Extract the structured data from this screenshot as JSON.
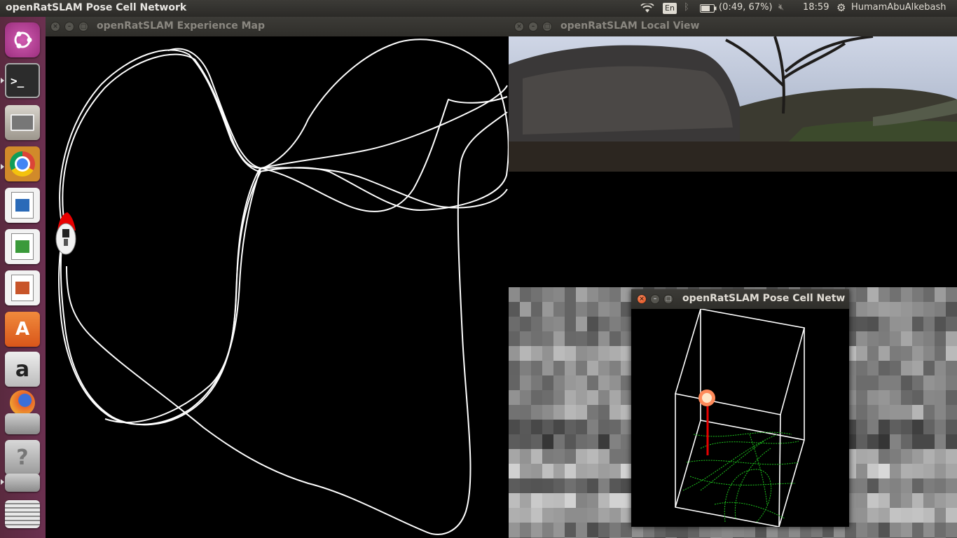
{
  "top_panel": {
    "active_window_title": "openRatSLAM Pose Cell Network",
    "keyboard_lang": "En",
    "battery_text": "(0:49, 67%)",
    "clock": "18:59",
    "username": "HumamAbuAlkebash",
    "icons": [
      "wifi-icon",
      "bluetooth-icon",
      "battery-icon",
      "volume-muted-icon",
      "gear-icon"
    ]
  },
  "launcher": {
    "items": [
      {
        "name": "ubuntu-dash",
        "glyph": "◉"
      },
      {
        "name": "terminal",
        "glyph": ">_"
      },
      {
        "name": "files",
        "glyph": "▭"
      },
      {
        "name": "chrome",
        "glyph": "●"
      },
      {
        "name": "writer",
        "glyph": "≡"
      },
      {
        "name": "calc",
        "glyph": "▦"
      },
      {
        "name": "impress",
        "glyph": "▤"
      },
      {
        "name": "software-center",
        "glyph": "A"
      },
      {
        "name": "amazon",
        "glyph": "a"
      },
      {
        "name": "firefox",
        "glyph": "◐"
      },
      {
        "name": "help",
        "glyph": "?"
      }
    ]
  },
  "windows": {
    "experience_map": {
      "title": "openRatSLAM Experience Map"
    },
    "local_view": {
      "title": "openRatSLAM Local View"
    },
    "pose_cell": {
      "title": "openRatSLAM Pose Cell Networ"
    }
  },
  "colors": {
    "panel_bg": "#2b2a27",
    "launcher_bg": "#5a2a3f",
    "close_button": "#df4b16",
    "trajectory": "#ffffff",
    "pose_activity": "#ff3a1a",
    "pose_trace": "#1ec81e"
  }
}
